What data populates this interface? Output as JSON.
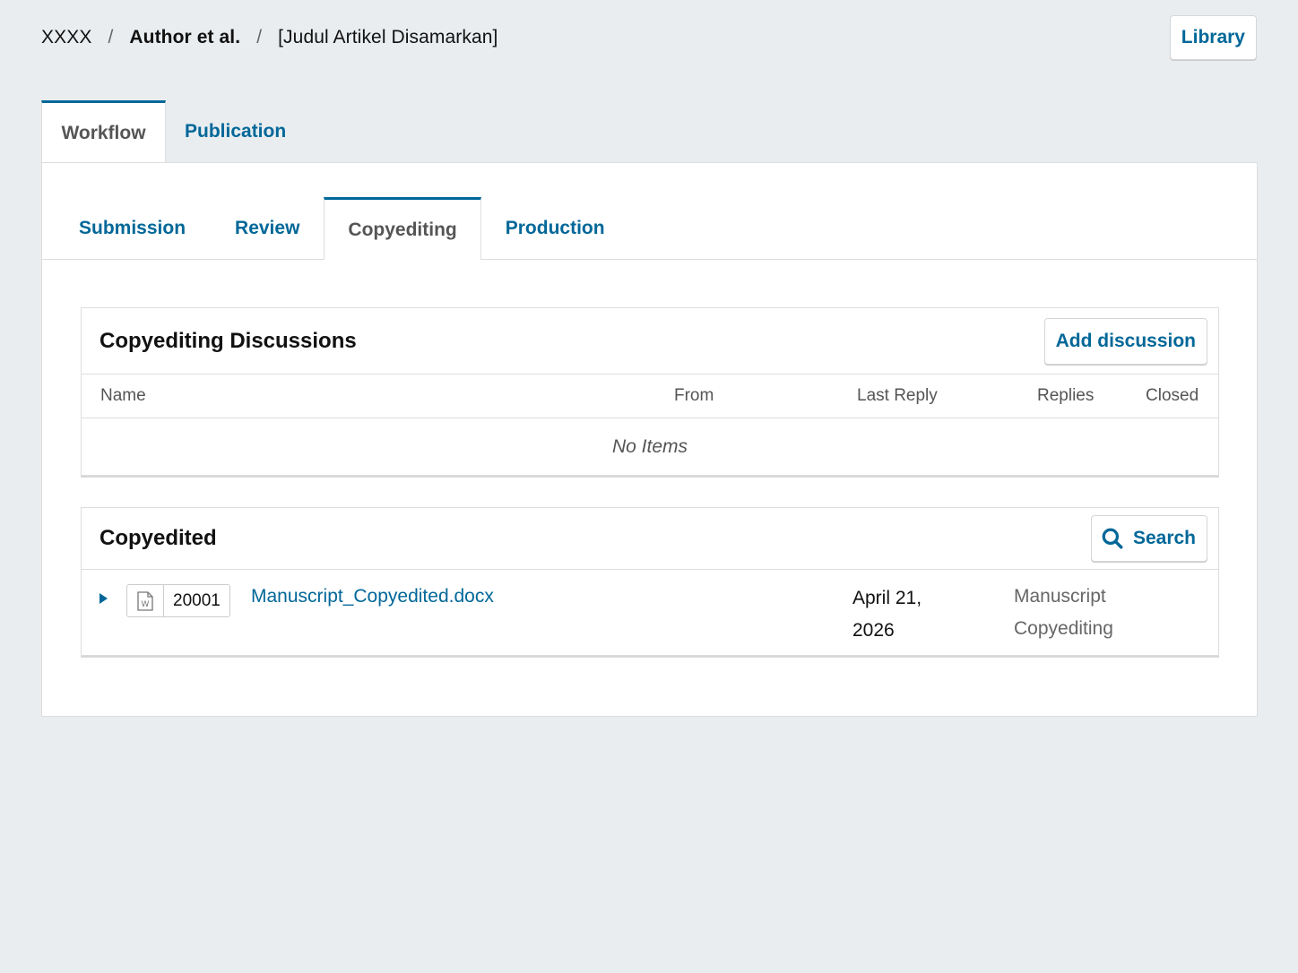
{
  "breadcrumb": {
    "context": "XXXX",
    "separator": "/",
    "author": "Author et al.",
    "title": "[Judul Artikel Disamarkan]"
  },
  "library_button": "Library",
  "top_tabs": [
    {
      "label": "Workflow",
      "active": true
    },
    {
      "label": "Publication",
      "active": false
    }
  ],
  "stage_tabs": [
    {
      "label": "Submission",
      "active": false
    },
    {
      "label": "Review",
      "active": false
    },
    {
      "label": "Copyediting",
      "active": true
    },
    {
      "label": "Production",
      "active": false
    }
  ],
  "discussions": {
    "title": "Copyediting Discussions",
    "add_button": "Add discussion",
    "columns": [
      "Name",
      "From",
      "Last Reply",
      "Replies",
      "Closed"
    ],
    "empty_text": "No Items"
  },
  "copyedited": {
    "title": "Copyedited",
    "search_button": "Search",
    "files": [
      {
        "id": "20001",
        "name": "Manuscript_Copyedited.docx",
        "date_line1": "April 21,",
        "date_line2": "2026",
        "genre_line1": "Manuscript",
        "genre_line2": "Copyediting",
        "icon": "word-doc-icon"
      }
    ]
  },
  "colors": {
    "accent": "#006798",
    "background": "#e9edf0",
    "panel": "#ffffff",
    "border": "#dddddd"
  }
}
